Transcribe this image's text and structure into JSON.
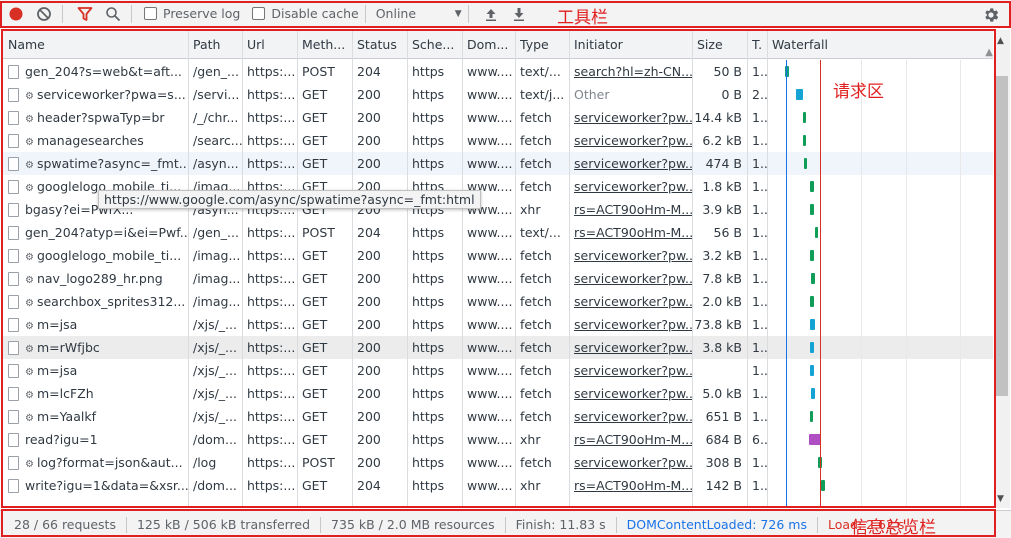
{
  "toolbar": {
    "preserve_log": "Preserve log",
    "disable_cache": "Disable cache",
    "throttling": "Online"
  },
  "annotations": {
    "toolbar": "工具栏",
    "requests": "请求区",
    "summary": "信息总览栏"
  },
  "columns": [
    "Name",
    "Path",
    "Url",
    "Meth...",
    "Status",
    "Sche...",
    "Dom...",
    "Type",
    "Initiator",
    "Size",
    "T.",
    "Waterfall"
  ],
  "rows": [
    {
      "name": "gen_204?s=web&t=aft...",
      "gear": false,
      "path": "/gen_...",
      "url": "https:...",
      "method": "POST",
      "status": "204",
      "scheme": "https",
      "domain": "www....",
      "type": "text/...",
      "initiator": "search?hl=zh-CN...",
      "init_link": true,
      "size": "50 B",
      "time": "1..."
    },
    {
      "name": "serviceworker?pwa=s...",
      "gear": true,
      "path": "/servi...",
      "url": "https:...",
      "method": "GET",
      "status": "200",
      "scheme": "https",
      "domain": "www....",
      "type": "text/j...",
      "initiator": "Other",
      "init_link": false,
      "size": "0 B",
      "time": "2..."
    },
    {
      "name": "header?spwaTyp=br",
      "gear": true,
      "path": "/_/chr...",
      "url": "https:...",
      "method": "GET",
      "status": "200",
      "scheme": "https",
      "domain": "www....",
      "type": "fetch",
      "initiator": "serviceworker?pw...",
      "init_link": true,
      "size": "14.4 kB",
      "time": "1..."
    },
    {
      "name": "managesearches",
      "gear": true,
      "path": "/searc...",
      "url": "https:...",
      "method": "GET",
      "status": "200",
      "scheme": "https",
      "domain": "www....",
      "type": "fetch",
      "initiator": "serviceworker?pw...",
      "init_link": true,
      "size": "6.2 kB",
      "time": "1..."
    },
    {
      "name": "spwatime?async=_fmt...",
      "gear": true,
      "path": "/asyn...",
      "url": "https:...",
      "method": "GET",
      "status": "200",
      "scheme": "https",
      "domain": "www....",
      "type": "fetch",
      "initiator": "serviceworker?pw...",
      "init_link": true,
      "size": "474 B",
      "time": "1..."
    },
    {
      "name": "googlelogo_mobile_ti...",
      "gear": true,
      "path": "/imag...",
      "url": "https:...",
      "method": "GET",
      "status": "200",
      "scheme": "https",
      "domain": "www....",
      "type": "fetch",
      "initiator": "serviceworker?pw...",
      "init_link": true,
      "size": "1.8 kB",
      "time": "1..."
    },
    {
      "name": "bgasy?ei=PwfX...",
      "gear": false,
      "path": "/asyn...",
      "url": "https:...",
      "method": "GET",
      "status": "200",
      "scheme": "https",
      "domain": "www....",
      "type": "xhr",
      "initiator": "rs=ACT90oHm-M...",
      "init_link": true,
      "size": "3.9 kB",
      "time": "1..."
    },
    {
      "name": "gen_204?atyp=i&ei=Pwf...",
      "gear": false,
      "path": "/gen_...",
      "url": "https:...",
      "method": "POST",
      "status": "204",
      "scheme": "https",
      "domain": "www....",
      "type": "text/...",
      "initiator": "rs=ACT90oHm-M...",
      "init_link": true,
      "size": "56 B",
      "time": "1..."
    },
    {
      "name": "googlelogo_mobile_ti...",
      "gear": true,
      "path": "/imag...",
      "url": "https:...",
      "method": "GET",
      "status": "200",
      "scheme": "https",
      "domain": "www....",
      "type": "fetch",
      "initiator": "serviceworker?pw...",
      "init_link": true,
      "size": "3.2 kB",
      "time": "1..."
    },
    {
      "name": "nav_logo289_hr.png",
      "gear": true,
      "path": "/imag...",
      "url": "https:...",
      "method": "GET",
      "status": "200",
      "scheme": "https",
      "domain": "www....",
      "type": "fetch",
      "initiator": "serviceworker?pw...",
      "init_link": true,
      "size": "7.8 kB",
      "time": "1..."
    },
    {
      "name": "searchbox_sprites312...",
      "gear": true,
      "path": "/imag...",
      "url": "https:...",
      "method": "GET",
      "status": "200",
      "scheme": "https",
      "domain": "www....",
      "type": "fetch",
      "initiator": "serviceworker?pw...",
      "init_link": true,
      "size": "2.0 kB",
      "time": "1..."
    },
    {
      "name": "m=jsa",
      "gear": true,
      "path": "/xjs/_...",
      "url": "https:...",
      "method": "GET",
      "status": "200",
      "scheme": "https",
      "domain": "www....",
      "type": "fetch",
      "initiator": "serviceworker?pw...",
      "init_link": true,
      "size": "73.8 kB",
      "time": "1..."
    },
    {
      "name": "m=rWfjbc",
      "gear": true,
      "path": "/xjs/_...",
      "url": "https:...",
      "method": "GET",
      "status": "200",
      "scheme": "https",
      "domain": "www....",
      "type": "fetch",
      "initiator": "serviceworker?pw...",
      "init_link": true,
      "size": "3.8 kB",
      "time": "1..."
    },
    {
      "name": "m=jsa",
      "gear": true,
      "path": "/xjs/_...",
      "url": "https:...",
      "method": "GET",
      "status": "200",
      "scheme": "https",
      "domain": "www....",
      "type": "fetch",
      "initiator": "serviceworker?pw...",
      "init_link": true,
      "size": "",
      "time": "1..."
    },
    {
      "name": "m=lcFZh",
      "gear": true,
      "path": "/xjs/_...",
      "url": "https:...",
      "method": "GET",
      "status": "200",
      "scheme": "https",
      "domain": "www....",
      "type": "fetch",
      "initiator": "serviceworker?pw...",
      "init_link": true,
      "size": "5.0 kB",
      "time": "1..."
    },
    {
      "name": "m=Yaalkf",
      "gear": true,
      "path": "/xjs/_...",
      "url": "https:...",
      "method": "GET",
      "status": "200",
      "scheme": "https",
      "domain": "www....",
      "type": "fetch",
      "initiator": "serviceworker?pw...",
      "init_link": true,
      "size": "651 B",
      "time": "1..."
    },
    {
      "name": "read?igu=1",
      "gear": false,
      "path": "/dom...",
      "url": "https:...",
      "method": "GET",
      "status": "200",
      "scheme": "https",
      "domain": "www....",
      "type": "xhr",
      "initiator": "rs=ACT90oHm-M...",
      "init_link": true,
      "size": "684 B",
      "time": "6..."
    },
    {
      "name": "log?format=json&aut...",
      "gear": true,
      "path": "/log",
      "url": "https:...",
      "method": "POST",
      "status": "200",
      "scheme": "https",
      "domain": "www....",
      "type": "fetch",
      "initiator": "serviceworker?pw...",
      "init_link": true,
      "size": "308 B",
      "time": "1..."
    },
    {
      "name": "write?igu=1&data=&xsr...",
      "gear": false,
      "path": "/dom...",
      "url": "https:...",
      "method": "GET",
      "status": "204",
      "scheme": "https",
      "domain": "www....",
      "type": "xhr",
      "initiator": "rs=ACT90oHm-M...",
      "init_link": true,
      "size": "142 B",
      "time": "1..."
    }
  ],
  "tooltip": "https://www.google.com/async/spwatime?async=_fmt:html",
  "status": {
    "requests": "28 / 66 requests",
    "transferred": "125 kB / 506 kB transferred",
    "resources": "735 kB / 2.0 MB resources",
    "finish": "Finish: 11.83 s",
    "dcl": "DOMContentLoaded: 726 ms",
    "load": "Load: 2.62 s"
  },
  "colors": {
    "record": "#d93025",
    "filter": "#d93025",
    "annotation": "#e02020",
    "dcl_line": "#1a73e8",
    "load_line": "#d93025"
  }
}
